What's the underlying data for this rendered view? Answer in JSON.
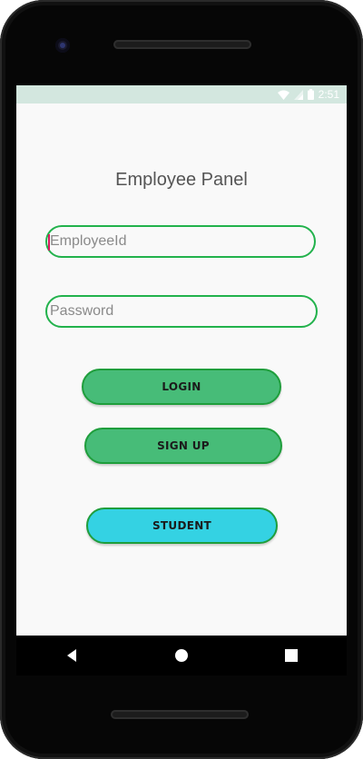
{
  "status_bar": {
    "time": "2:51",
    "icons": [
      "wifi-icon",
      "cell-signal-icon",
      "battery-icon"
    ]
  },
  "page": {
    "title": "Employee Panel"
  },
  "form": {
    "employee_id": {
      "value": "",
      "placeholder": "EmployeeId"
    },
    "password": {
      "value": "",
      "placeholder": "Password"
    }
  },
  "buttons": {
    "login": "LOGIN",
    "signup": "SIGN UP",
    "student": "STUDENT"
  },
  "nav_bar": {
    "icons": [
      "back-icon",
      "home-icon",
      "recents-icon"
    ]
  },
  "colors": {
    "accent_green": "#47bc78",
    "border_green": "#22b24c",
    "student_cyan": "#34d2e3",
    "status_bar_bg": "#d3e7df",
    "cursor_pink": "#d81b60"
  }
}
